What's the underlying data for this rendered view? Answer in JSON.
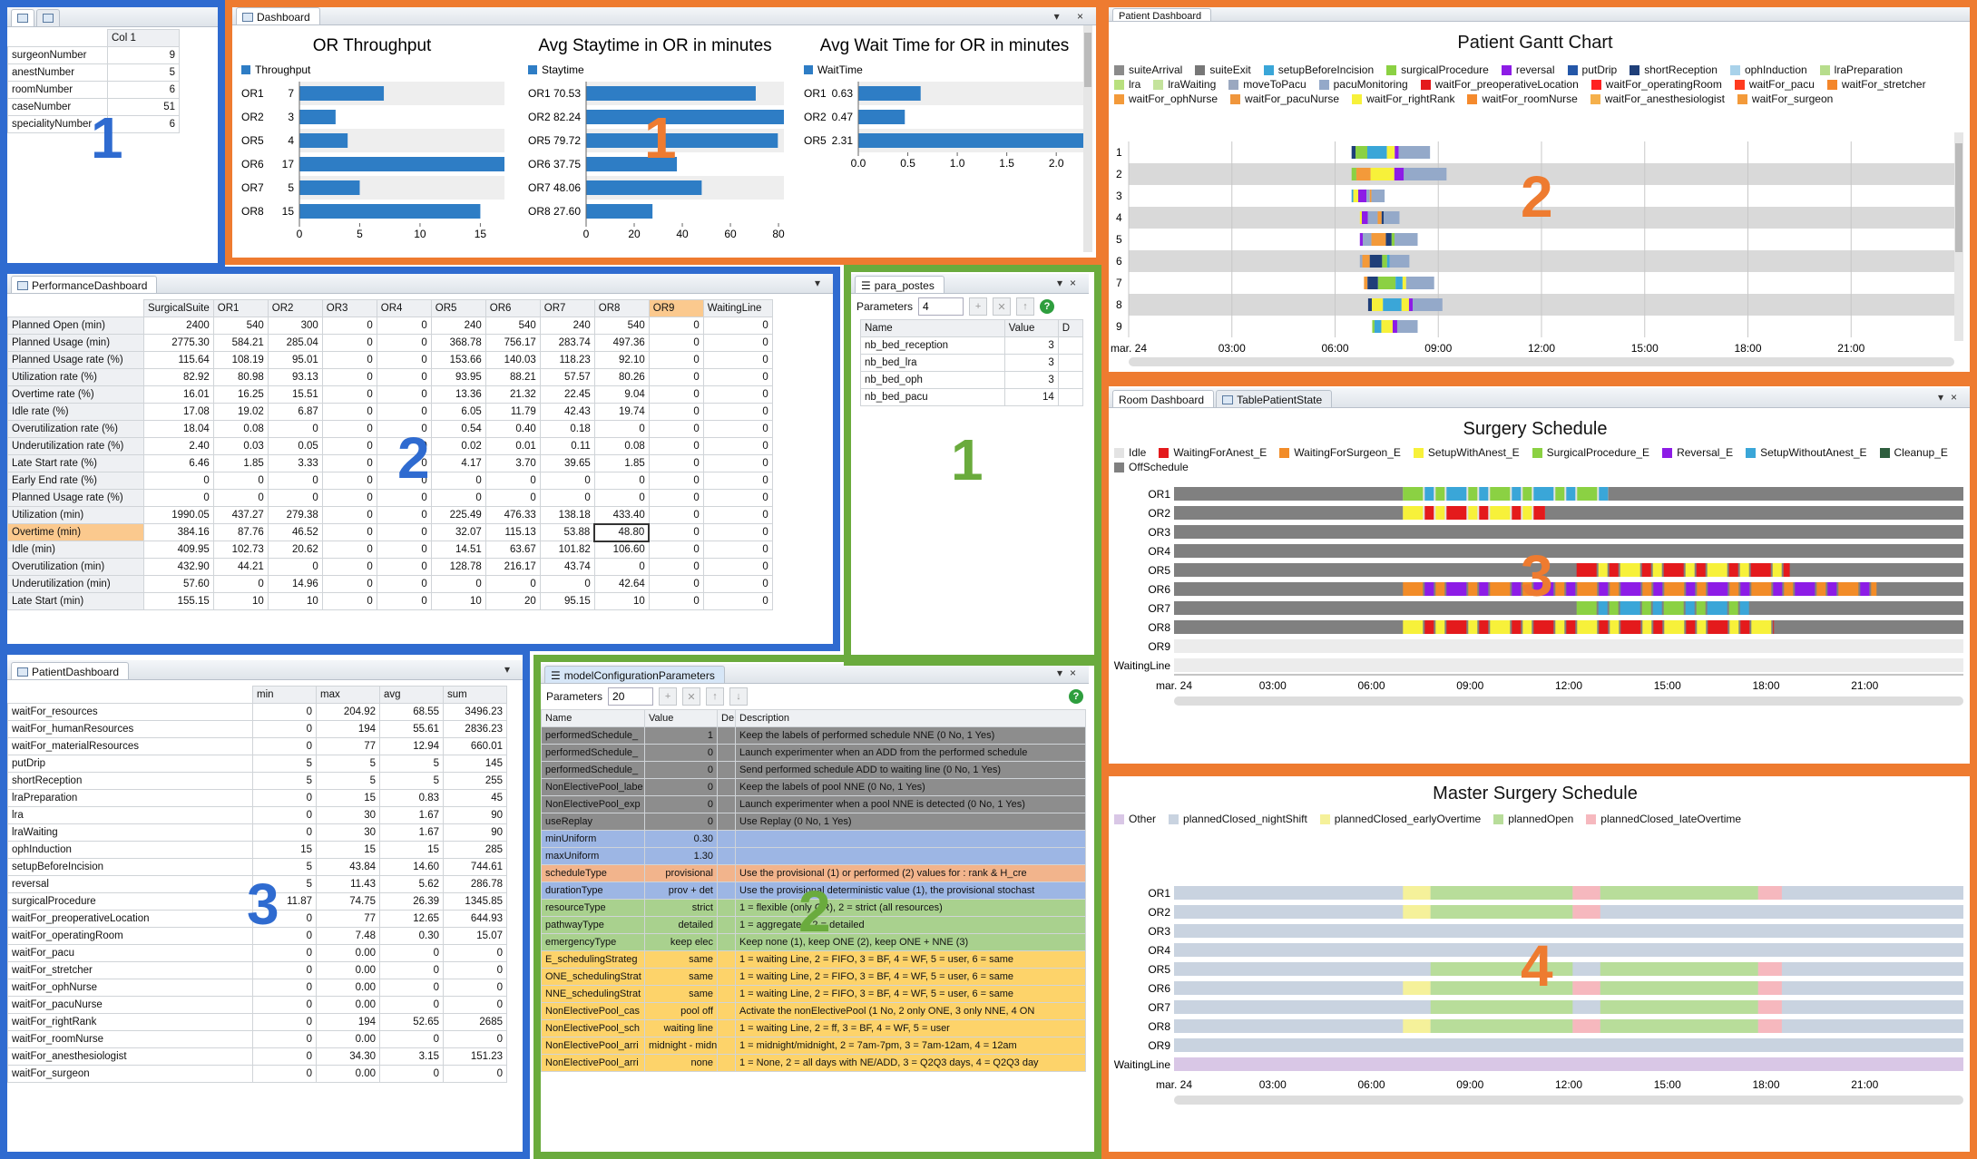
{
  "colors": {
    "blue": "#2f6bd0",
    "orange": "#ee7b30",
    "green": "#6aab3d",
    "bar": "#2e7dc5"
  },
  "frame_numbers": {
    "b1": "1",
    "b2": "2",
    "b3": "3",
    "o1": "1",
    "o2": "2",
    "o3": "3",
    "o4": "4",
    "g1": "1",
    "g2": "2"
  },
  "topleft": {
    "header": "Col 1",
    "rows": [
      [
        "surgeonNumber",
        "9"
      ],
      [
        "anestNumber",
        "5"
      ],
      [
        "roomNumber",
        "6"
      ],
      [
        "caseNumber",
        "51"
      ],
      [
        "specialityNumber",
        "6"
      ]
    ]
  },
  "dashboard": {
    "tab": "Dashboard",
    "charts": [
      {
        "title": "OR Throughput",
        "legend": "Throughput",
        "cats": [
          "OR1",
          "OR2",
          "OR5",
          "OR6",
          "OR7",
          "OR8"
        ],
        "labels": [
          "7",
          "3",
          "4",
          "17",
          "5",
          "15"
        ],
        "vals": [
          7,
          3,
          4,
          17,
          5,
          15
        ],
        "max": 17,
        "ticks": [
          "0",
          "5",
          "10",
          "15"
        ],
        "tickvals": [
          0,
          5,
          10,
          15
        ]
      },
      {
        "title": "Avg Staytime in OR in minutes",
        "legend": "Staytime",
        "cats": [
          "OR1",
          "OR2",
          "OR5",
          "OR6",
          "OR7",
          "OR8"
        ],
        "labels": [
          "70.53",
          "82.24",
          "79.72",
          "37.75",
          "48.06",
          "27.60"
        ],
        "vals": [
          70.53,
          82.24,
          79.72,
          37.75,
          48.06,
          27.6
        ],
        "max": 82.24,
        "ticks": [
          "0",
          "20",
          "40",
          "60",
          "80"
        ],
        "tickvals": [
          0,
          20,
          40,
          60,
          80
        ]
      },
      {
        "title": "Avg Wait Time for OR in minutes",
        "legend": "WaitTime",
        "cats": [
          "OR1",
          "OR2",
          "OR5"
        ],
        "labels": [
          "0.63",
          "0.47",
          "2.31"
        ],
        "vals": [
          0.63,
          0.47,
          2.31
        ],
        "max": 2.31,
        "ticks": [
          "0.0",
          "0.5",
          "1.0",
          "1.5",
          "2.0"
        ],
        "tickvals": [
          0,
          0.5,
          1,
          1.5,
          2
        ]
      }
    ]
  },
  "perf": {
    "tab": "PerformanceDashboard",
    "cols": [
      "SurgicalSuite",
      "OR1",
      "OR2",
      "OR3",
      "OR4",
      "OR5",
      "OR6",
      "OR7",
      "OR8",
      "OR9",
      "WaitingLine"
    ],
    "rows": [
      [
        "Planned Open (min)",
        "2400",
        "540",
        "300",
        "0",
        "0",
        "240",
        "540",
        "240",
        "540",
        "0",
        "0"
      ],
      [
        "Planned Usage (min)",
        "2775.30",
        "584.21",
        "285.04",
        "0",
        "0",
        "368.78",
        "756.17",
        "283.74",
        "497.36",
        "0",
        "0"
      ],
      [
        "Planned Usage rate (%)",
        "115.64",
        "108.19",
        "95.01",
        "0",
        "0",
        "153.66",
        "140.03",
        "118.23",
        "92.10",
        "0",
        "0"
      ],
      [
        "Utilization rate (%)",
        "82.92",
        "80.98",
        "93.13",
        "0",
        "0",
        "93.95",
        "88.21",
        "57.57",
        "80.26",
        "0",
        "0"
      ],
      [
        "Overtime rate (%)",
        "16.01",
        "16.25",
        "15.51",
        "0",
        "0",
        "13.36",
        "21.32",
        "22.45",
        "9.04",
        "0",
        "0"
      ],
      [
        "Idle rate (%)",
        "17.08",
        "19.02",
        "6.87",
        "0",
        "0",
        "6.05",
        "11.79",
        "42.43",
        "19.74",
        "0",
        "0"
      ],
      [
        "Overutilization rate (%)",
        "18.04",
        "0.08",
        "0",
        "0",
        "0",
        "0.54",
        "0.40",
        "0.18",
        "0",
        "0",
        "0"
      ],
      [
        "Underutilization rate (%)",
        "2.40",
        "0.03",
        "0.05",
        "0",
        "0",
        "0.02",
        "0.01",
        "0.11",
        "0.08",
        "0",
        "0"
      ],
      [
        "Late Start rate (%)",
        "6.46",
        "1.85",
        "3.33",
        "0",
        "0",
        "4.17",
        "3.70",
        "39.65",
        "1.85",
        "0",
        "0"
      ],
      [
        "Early End rate (%)",
        "0",
        "0",
        "0",
        "0",
        "0",
        "0",
        "0",
        "0",
        "0",
        "0",
        "0"
      ],
      [
        "Planned Usage rate (%)",
        "0",
        "0",
        "0",
        "0",
        "0",
        "0",
        "0",
        "0",
        "0",
        "0",
        "0"
      ],
      [
        "Utilization (min)",
        "1990.05",
        "437.27",
        "279.38",
        "0",
        "0",
        "225.49",
        "476.33",
        "138.18",
        "433.40",
        "0",
        "0"
      ],
      [
        "Overtime (min)",
        "384.16",
        "87.76",
        "46.52",
        "0",
        "0",
        "32.07",
        "115.13",
        "53.88",
        "48.80",
        "0",
        "0"
      ],
      [
        "Idle (min)",
        "409.95",
        "102.73",
        "20.62",
        "0",
        "0",
        "14.51",
        "63.67",
        "101.82",
        "106.60",
        "0",
        "0"
      ],
      [
        "Overutilization (min)",
        "432.90",
        "44.21",
        "0",
        "0",
        "0",
        "128.78",
        "216.17",
        "43.74",
        "0",
        "0",
        "0"
      ],
      [
        "Underutilization (min)",
        "57.60",
        "0",
        "14.96",
        "0",
        "0",
        "0",
        "0",
        "0",
        "42.64",
        "0",
        "0"
      ],
      [
        "Late Start (min)",
        "155.15",
        "10",
        "10",
        "0",
        "0",
        "10",
        "20",
        "95.15",
        "10",
        "0",
        "0"
      ]
    ]
  },
  "patient": {
    "tab": "PatientDashboard",
    "cols": [
      "min",
      "max",
      "avg",
      "sum"
    ],
    "rows": [
      [
        "waitFor_resources",
        "0",
        "204.92",
        "68.55",
        "3496.23"
      ],
      [
        "waitFor_humanResources",
        "0",
        "194",
        "55.61",
        "2836.23"
      ],
      [
        "waitFor_materialResources",
        "0",
        "77",
        "12.94",
        "660.01"
      ],
      [
        "putDrip",
        "5",
        "5",
        "5",
        "145"
      ],
      [
        "shortReception",
        "5",
        "5",
        "5",
        "255"
      ],
      [
        "lraPreparation",
        "0",
        "15",
        "0.83",
        "45"
      ],
      [
        "lra",
        "0",
        "30",
        "1.67",
        "90"
      ],
      [
        "lraWaiting",
        "0",
        "30",
        "1.67",
        "90"
      ],
      [
        "ophInduction",
        "15",
        "15",
        "15",
        "285"
      ],
      [
        "setupBeforeIncision",
        "5",
        "43.84",
        "14.60",
        "744.61"
      ],
      [
        "reversal",
        "5",
        "11.43",
        "5.62",
        "286.78"
      ],
      [
        "surgicalProcedure",
        "11.87",
        "74.75",
        "26.39",
        "1345.85"
      ],
      [
        "waitFor_preoperativeLocation",
        "0",
        "77",
        "12.65",
        "644.93"
      ],
      [
        "waitFor_operatingRoom",
        "0",
        "7.48",
        "0.30",
        "15.07"
      ],
      [
        "waitFor_pacu",
        "0",
        "0.00",
        "0",
        "0"
      ],
      [
        "waitFor_stretcher",
        "0",
        "0.00",
        "0",
        "0"
      ],
      [
        "waitFor_ophNurse",
        "0",
        "0.00",
        "0",
        "0"
      ],
      [
        "waitFor_pacuNurse",
        "0",
        "0.00",
        "0",
        "0"
      ],
      [
        "waitFor_rightRank",
        "0",
        "194",
        "52.65",
        "2685"
      ],
      [
        "waitFor_roomNurse",
        "0",
        "0.00",
        "0",
        "0"
      ],
      [
        "waitFor_anesthesiologist",
        "0",
        "34.30",
        "3.15",
        "151.23"
      ],
      [
        "waitFor_surgeon",
        "0",
        "0.00",
        "0",
        "0"
      ]
    ]
  },
  "para": {
    "tab": "para_postes",
    "label": "Parameters",
    "count": "4",
    "cols": [
      "Name",
      "Value",
      "D"
    ],
    "rows": [
      [
        "nb_bed_reception",
        "3"
      ],
      [
        "nb_bed_lra",
        "3"
      ],
      [
        "nb_bed_oph",
        "3"
      ],
      [
        "nb_bed_pacu",
        "14"
      ]
    ]
  },
  "model": {
    "tab": "modelConfigurationParameters",
    "label": "Parameters",
    "count": "20",
    "cols": [
      "Name",
      "Value",
      "De",
      "Description"
    ],
    "rows": [
      [
        "performedSchedule_",
        "1",
        "Keep the labels of performed schedule NNE (0 No, 1 Yes)",
        "#8d8d8d"
      ],
      [
        "performedSchedule_",
        "0",
        "Launch experimenter when an ADD from the performed schedule",
        "#8d8d8d"
      ],
      [
        "performedSchedule_",
        "0",
        "Send performed schedule ADD to waiting line (0 No, 1 Yes)",
        "#8d8d8d"
      ],
      [
        "NonElectivePool_labe",
        "0",
        "Keep the labels of pool NNE (0 No, 1 Yes)",
        "#8d8d8d"
      ],
      [
        "NonElectivePool_exp",
        "0",
        "Launch experimenter when a pool NNE is detected (0 No, 1 Yes)",
        "#8d8d8d"
      ],
      [
        "useReplay",
        "0",
        "Use Replay (0 No, 1 Yes)",
        "#8d8d8d"
      ],
      [
        "minUniform",
        "0.30",
        "",
        "#9db6e4"
      ],
      [
        "maxUniform",
        "1.30",
        "",
        "#9db6e4"
      ],
      [
        "scheduleType",
        "provisional",
        "Use the provisional (1) or performed (2) values for : rank & H_cre",
        "#f2b48c"
      ],
      [
        "durationType",
        "prov + det",
        "Use the provisional deterministic value (1), the provisional stochast",
        "#9db6e4"
      ],
      [
        "resourceType",
        "strict",
        "1 = flexible (only OR), 2 = strict (all resources)",
        "#a9d18e"
      ],
      [
        "pathwayType",
        "detailed",
        "1 = aggregated, 2 = detailed",
        "#a9d18e"
      ],
      [
        "emergencyType",
        "keep elec",
        "Keep none (1), keep ONE (2), keep ONE + NNE (3)",
        "#a9d18e"
      ],
      [
        "E_schedulingStrateg",
        "same",
        "1 = waiting Line, 2 = FIFO, 3 = BF, 4 = WF, 5 = user, 6 = same",
        "#fdd36a"
      ],
      [
        "ONE_schedulingStrat",
        "same",
        "1 = waiting Line, 2 = FIFO, 3 = BF, 4 = WF, 5 = user, 6 = same",
        "#fdd36a"
      ],
      [
        "NNE_schedulingStrat",
        "same",
        "1 = waiting Line, 2 = FIFO, 3 = BF, 4 = WF, 5 = user, 6 = same",
        "#fdd36a"
      ],
      [
        "NonElectivePool_cas",
        "pool off",
        "Activate the nonElectivePool (1 No, 2 only ONE, 3 only NNE, 4 ON",
        "#fdd36a"
      ],
      [
        "NonElectivePool_sch",
        "waiting line",
        "1 = waiting Line, 2 = ff, 3 = BF, 4 = WF, 5 = user",
        "#fdd36a"
      ],
      [
        "NonElectivePool_arri",
        "midnight - midnight",
        "1 = midnight/midnight, 2 = 7am-7pm, 3 = 7am-12am, 4 = 12am",
        "#fdd36a"
      ],
      [
        "NonElectivePool_arri",
        "none",
        "1 = None, 2 = all days with NE/ADD, 3 = Q2Q3 days, 4 = Q2Q3 day",
        "#fdd36a"
      ]
    ]
  },
  "gantt": {
    "tab": "Patient Dashboard",
    "title": "Patient Gantt Chart",
    "legend": [
      [
        "suiteArrival",
        "#8b8b8b"
      ],
      [
        "suiteExit",
        "#777"
      ],
      [
        "setupBeforeIncision",
        "#3aa6d8"
      ],
      [
        "surgicalProcedure",
        "#8bd143"
      ],
      [
        "reversal",
        "#8d1ce6"
      ],
      [
        "putDrip",
        "#2457a8"
      ],
      [
        "shortReception",
        "#1f3f79"
      ],
      [
        "ophInduction",
        "#a9d2ea"
      ],
      [
        "lraPreparation",
        "#b7dd8c"
      ],
      [
        "lra",
        "#b8e07e"
      ],
      [
        "lraWaiting",
        "#c4e39c"
      ],
      [
        "moveToPacu",
        "#9aa8c0"
      ],
      [
        "pacuMonitoring",
        "#94a9c9"
      ],
      [
        "waitFor_preoperativeLocation",
        "#e41a1c"
      ],
      [
        "waitFor_operatingRoom",
        "#ff2222"
      ],
      [
        "waitFor_pacu",
        "#ff3b1f"
      ],
      [
        "waitFor_stretcher",
        "#f4862a"
      ],
      [
        "waitFor_ophNurse",
        "#f39a3a"
      ],
      [
        "waitFor_pacuNurse",
        "#f0963c"
      ],
      [
        "waitFor_rightRank",
        "#f7f13a"
      ],
      [
        "waitFor_roomNurse",
        "#f58a2d"
      ],
      [
        "waitFor_anesthesiologist",
        "#f5b04b"
      ],
      [
        "waitFor_surgeon",
        "#f39a3a"
      ]
    ],
    "rows": [
      "1",
      "2",
      "3",
      "4",
      "5",
      "6",
      "7",
      "8",
      "9"
    ],
    "xticks": [
      "mar. 24",
      "03:00",
      "06:00",
      "09:00",
      "12:00",
      "15:00",
      "18:00",
      "21:00"
    ]
  },
  "surgery": {
    "tabs": [
      "Room Dashboard",
      "TablePatientState"
    ],
    "title": "Surgery Schedule",
    "legend": [
      [
        "Idle",
        "#e3e3e3"
      ],
      [
        "WaitingForAnest_E",
        "#e41a1c"
      ],
      [
        "WaitingForSurgeon_E",
        "#f28c28"
      ],
      [
        "SetupWithAnest_E",
        "#f7f13a"
      ],
      [
        "SurgicalProcedure_E",
        "#8bd143"
      ],
      [
        "Reversal_E",
        "#8d1ce6"
      ],
      [
        "SetupWithoutAnest_E",
        "#3aa6d8"
      ],
      [
        "Cleanup_E",
        "#2e5e3e"
      ],
      [
        "OffSchedule",
        "#808080"
      ]
    ],
    "rows": [
      "OR1",
      "OR2",
      "OR3",
      "OR4",
      "OR5",
      "OR6",
      "OR7",
      "OR8",
      "OR9",
      "WaitingLine"
    ],
    "xticks": [
      "mar. 24",
      "03:00",
      "06:00",
      "09:00",
      "12:00",
      "15:00",
      "18:00",
      "21:00"
    ]
  },
  "master": {
    "title": "Master Surgery Schedule",
    "legend": [
      [
        "Other",
        "#d9c7e6"
      ],
      [
        "plannedClosed_nightShift",
        "#c9d3e0"
      ],
      [
        "plannedClosed_earlyOvertime",
        "#f5f19a"
      ],
      [
        "plannedOpen",
        "#b8dd9a"
      ],
      [
        "plannedClosed_lateOvertime",
        "#f6b8be"
      ]
    ],
    "rows": [
      "OR1",
      "OR2",
      "OR3",
      "OR4",
      "OR5",
      "OR6",
      "OR7",
      "OR8",
      "OR9",
      "WaitingLine"
    ],
    "xticks": [
      "mar. 24",
      "03:00",
      "06:00",
      "09:00",
      "12:00",
      "15:00",
      "18:00",
      "21:00"
    ]
  }
}
